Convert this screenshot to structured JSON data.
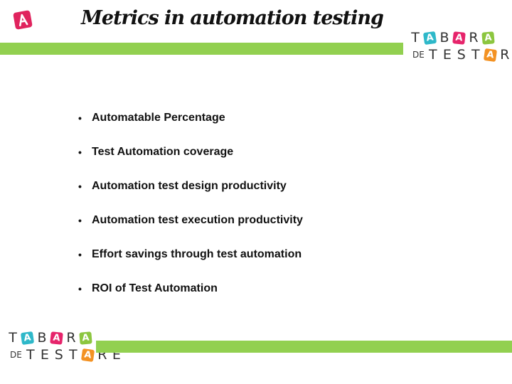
{
  "slide": {
    "title": "Metrics in automation testing",
    "badge_icon": "a-letter-badge-icon",
    "accent_color": "#92d050",
    "badge_color": "#e0245e"
  },
  "logo": {
    "row1": [
      "T",
      "A",
      "B",
      "A",
      "R",
      "A"
    ],
    "row2_prefix": "DE",
    "row2": [
      "T",
      "E",
      "S",
      "T",
      "A",
      "R",
      "E"
    ],
    "tile_colors": {
      "teal": "#2eb8c9",
      "magenta": "#e6246b",
      "green": "#8cc63f",
      "orange": "#f39223"
    }
  },
  "bullets": [
    {
      "text": "Automatable Percentage"
    },
    {
      "text": "Test Automation coverage"
    },
    {
      "text": "Automation test design productivity"
    },
    {
      "text": "Automation test execution productivity"
    },
    {
      "text": "Effort savings through test automation"
    },
    {
      "text": "ROI of Test Automation"
    }
  ],
  "bullet_glyph": "•"
}
